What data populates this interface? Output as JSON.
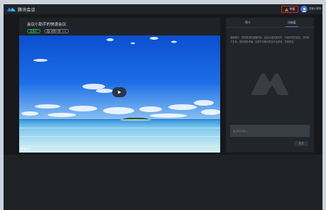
{
  "app": {
    "name": "腾讯会议"
  },
  "topbar": {
    "warning_label": "举报",
    "user_name": "游客小程序"
  },
  "meeting": {
    "title": "会议小助手的快速会议",
    "status_tag": "直播中",
    "viewers_label": "观看人数",
    "viewers_count": "1人",
    "video_watermark": "腾讯会议"
  },
  "side_panel": {
    "tabs": [
      {
        "label": "简介",
        "active": false
      },
      {
        "label": "讨论区",
        "active": true
      }
    ],
    "notice": "温馨提示：您所看到的直播内容，由会议组织者发布，为保护您的权益，请勿私下交易，谨防网络诈骗。请遵守法律法规及平台规则，文明发言。",
    "input_placeholder": "说点什么吧...",
    "send_label": "发送"
  },
  "colors": {
    "accent": "#3d73d8",
    "live_green": "#3cc472",
    "warning_red": "#e02020"
  },
  "icons": {
    "logo": "tencent-meeting-logo",
    "warning": "warning-triangle-icon",
    "avatar": "user-avatar",
    "play": "play-icon",
    "viewers": "viewers-icon"
  }
}
